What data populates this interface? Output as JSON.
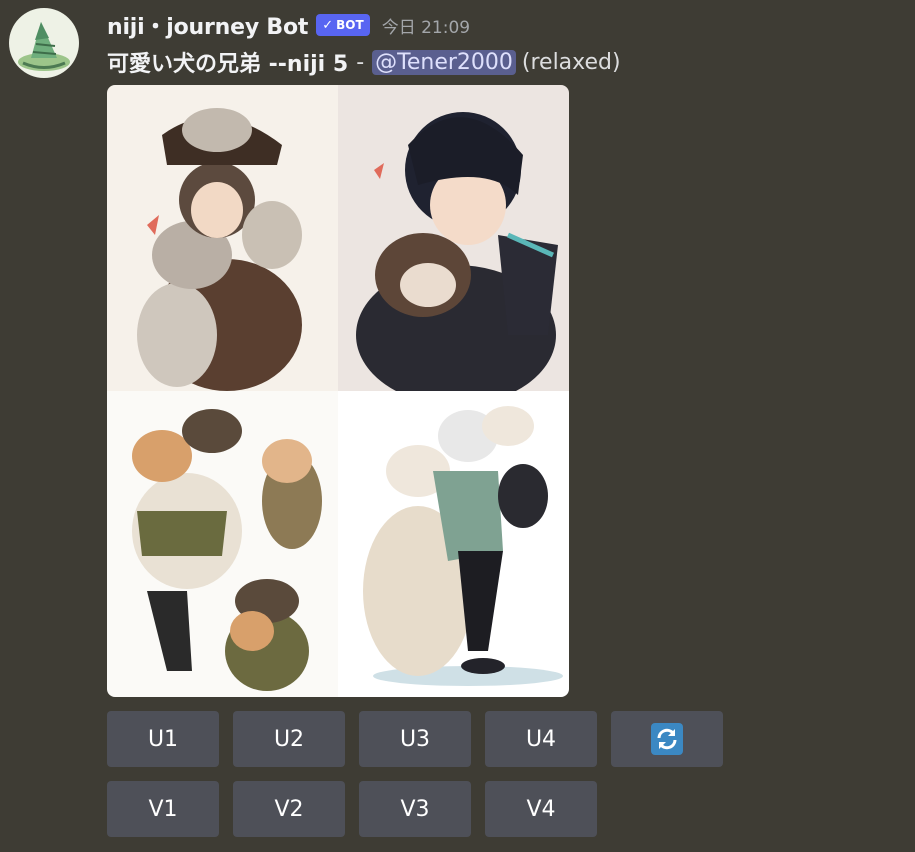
{
  "message": {
    "username": "niji・journey Bot",
    "bot_badge": "BOT",
    "timestamp": "今日 21:09",
    "prompt": "可愛い犬の兄弟 --niji 5",
    "separator": "-",
    "mention": "@Tener2000",
    "mode": "(relaxed)"
  },
  "images": [
    {
      "name": "image-top-left"
    },
    {
      "name": "image-top-right"
    },
    {
      "name": "image-bottom-left"
    },
    {
      "name": "image-bottom-right"
    }
  ],
  "buttons": {
    "upscale": [
      "U1",
      "U2",
      "U3",
      "U4"
    ],
    "variation": [
      "V1",
      "V2",
      "V3",
      "V4"
    ],
    "reroll_icon": "refresh-icon"
  },
  "colors": {
    "background": "#3e3c34",
    "button": "#4e5058",
    "bot_badge": "#5865f2",
    "mention_bg": "#5a5f8f",
    "refresh": "#3b88c3"
  }
}
